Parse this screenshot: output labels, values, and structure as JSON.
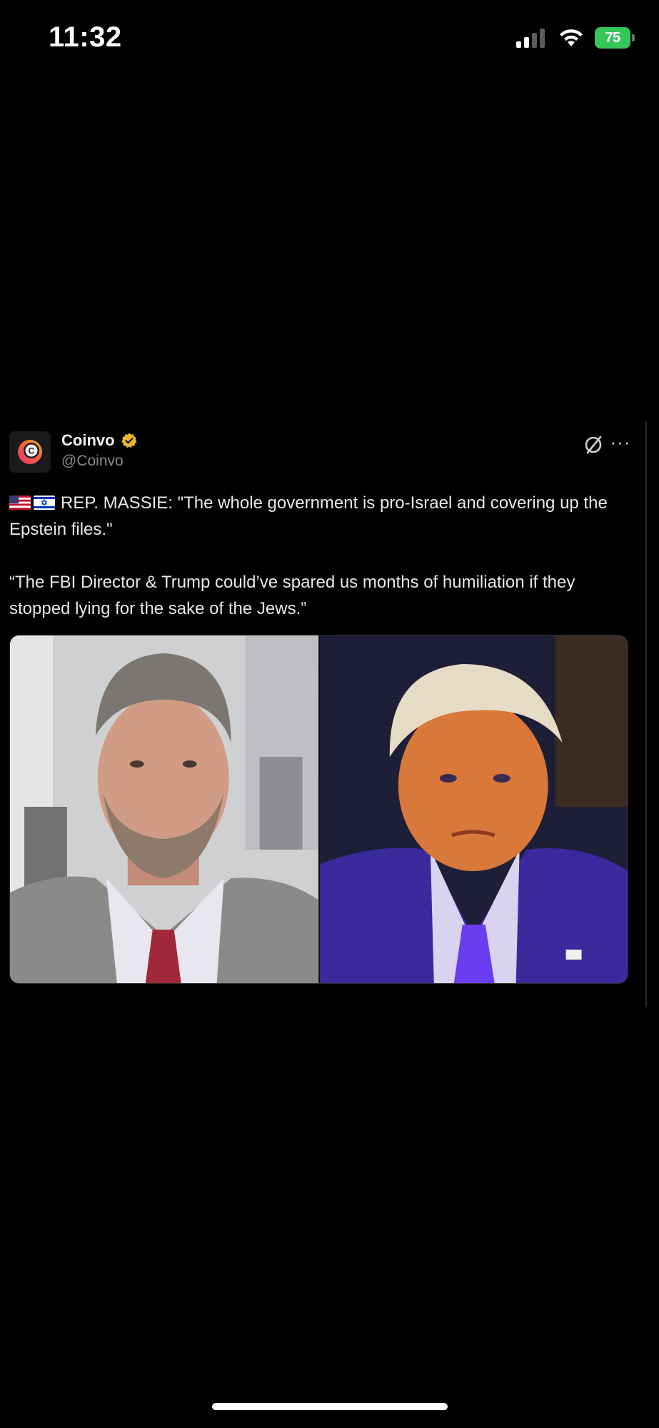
{
  "status_bar": {
    "time": "11:32",
    "battery_level": "75",
    "signal_icon": "cellular-signal-icon",
    "wifi_icon": "wifi-icon",
    "battery_color": "#34c759"
  },
  "tweet": {
    "author": {
      "name": "Coinvo",
      "handle": "@Coinvo",
      "verified": true,
      "verified_color": "#e8b82e"
    },
    "flags": [
      "us-flag-icon",
      "israel-flag-icon"
    ],
    "text_line_1": "REP. MASSIE: \"The whole government is pro-Israel and covering up the Epstein files.\"",
    "text_line_2": "“The FBI Director & Trump could’ve spared us months of humiliation if they stopped lying for the sake of the Jews.”",
    "media": {
      "left_image": "man-with-beard-photo",
      "right_image": "man-in-purple-suit-photo"
    },
    "actions": {
      "grok_icon": "grok-icon",
      "more_icon": "more-options-icon"
    }
  }
}
